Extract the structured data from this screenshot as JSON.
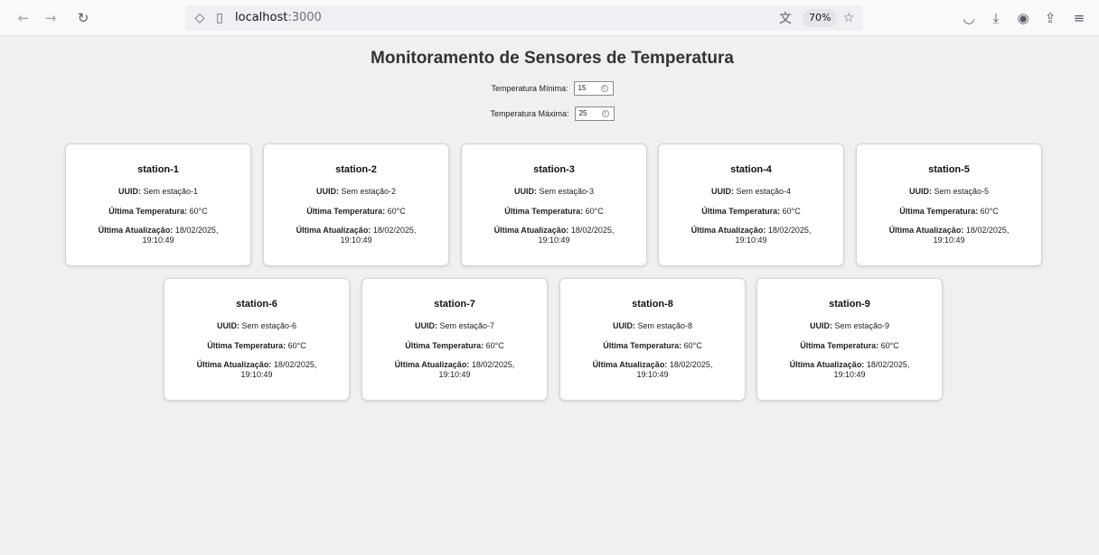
{
  "browser": {
    "url_host": "localhost",
    "url_port": ":3000",
    "zoom": "70%"
  },
  "page": {
    "title": "Monitoramento de Sensores de Temperatura",
    "min_label": "Temperatura Mínima:",
    "min_value": "15",
    "max_label": "Temperatura Máxima:",
    "max_value": "25"
  },
  "labels": {
    "uuid": "UUID:",
    "last_temp": "Última Temperatura:",
    "last_update": "Última Atualização:"
  },
  "stations": [
    {
      "name": "station-1",
      "uuid": "Sem estação-1",
      "temp": "60°C",
      "date": "18/02/2025,",
      "time": "19:10:49"
    },
    {
      "name": "station-2",
      "uuid": "Sem estação-2",
      "temp": "60°C",
      "date": "18/02/2025,",
      "time": "19:10:49"
    },
    {
      "name": "station-3",
      "uuid": "Sem estação-3",
      "temp": "60°C",
      "date": "18/02/2025,",
      "time": "19:10:49"
    },
    {
      "name": "station-4",
      "uuid": "Sem estação-4",
      "temp": "60°C",
      "date": "18/02/2025,",
      "time": "19:10:49"
    },
    {
      "name": "station-5",
      "uuid": "Sem estação-5",
      "temp": "60°C",
      "date": "18/02/2025,",
      "time": "19:10:49"
    },
    {
      "name": "station-6",
      "uuid": "Sem estação-6",
      "temp": "60°C",
      "date": "18/02/2025,",
      "time": "19:10:49"
    },
    {
      "name": "station-7",
      "uuid": "Sem estação-7",
      "temp": "60°C",
      "date": "18/02/2025,",
      "time": "19:10:49"
    },
    {
      "name": "station-8",
      "uuid": "Sem estação-8",
      "temp": "60°C",
      "date": "18/02/2025,",
      "time": "19:10:49"
    },
    {
      "name": "station-9",
      "uuid": "Sem estação-9",
      "temp": "60°C",
      "date": "18/02/2025,",
      "time": "19:10:49"
    }
  ]
}
